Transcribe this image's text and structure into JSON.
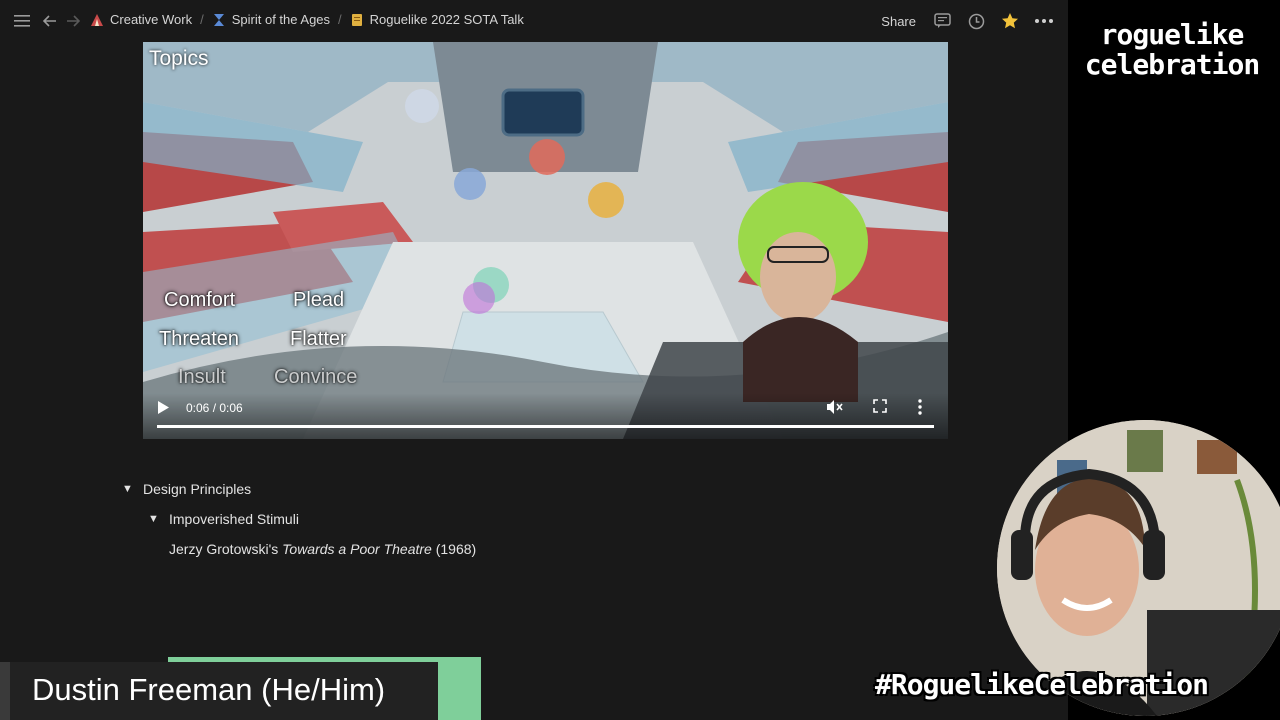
{
  "breadcrumb": [
    {
      "label": "Creative Work",
      "icon": "tent-icon",
      "color": "#c94a4a"
    },
    {
      "label": "Spirit of the Ages",
      "icon": "hourglass-icon",
      "color": "#5a8ad6"
    },
    {
      "label": "Roguelike 2022 SOTA Talk",
      "icon": "scroll-icon",
      "color": "#e0b040"
    }
  ],
  "topbar": {
    "share_label": "Share",
    "icons": [
      "comment-icon",
      "clock-icon",
      "star-icon",
      "more-icon"
    ],
    "star_color": "#f2c23a"
  },
  "video": {
    "topics_label": "Topics",
    "options": [
      "Comfort",
      "Plead",
      "Threaten",
      "Flatter",
      "Insult",
      "Convince"
    ],
    "time": "0:06 / 0:06",
    "progress": 1.0
  },
  "outline": {
    "design_principles": "Design Principles",
    "impoverished_stimuli": "Impoverished Stimuli",
    "quote_prefix": "Jerzy Grotowski's ",
    "quote_title": "Towards a Poor Theatre",
    "quote_suffix": " (1968)"
  },
  "overlay": {
    "logo_line1": "roguelike",
    "logo_line2": "celebration",
    "hashtag": "#RoguelikeCelebration",
    "speaker_name": "Dustin Freeman (He/Him)",
    "accent_green": "#7fcf9a"
  }
}
